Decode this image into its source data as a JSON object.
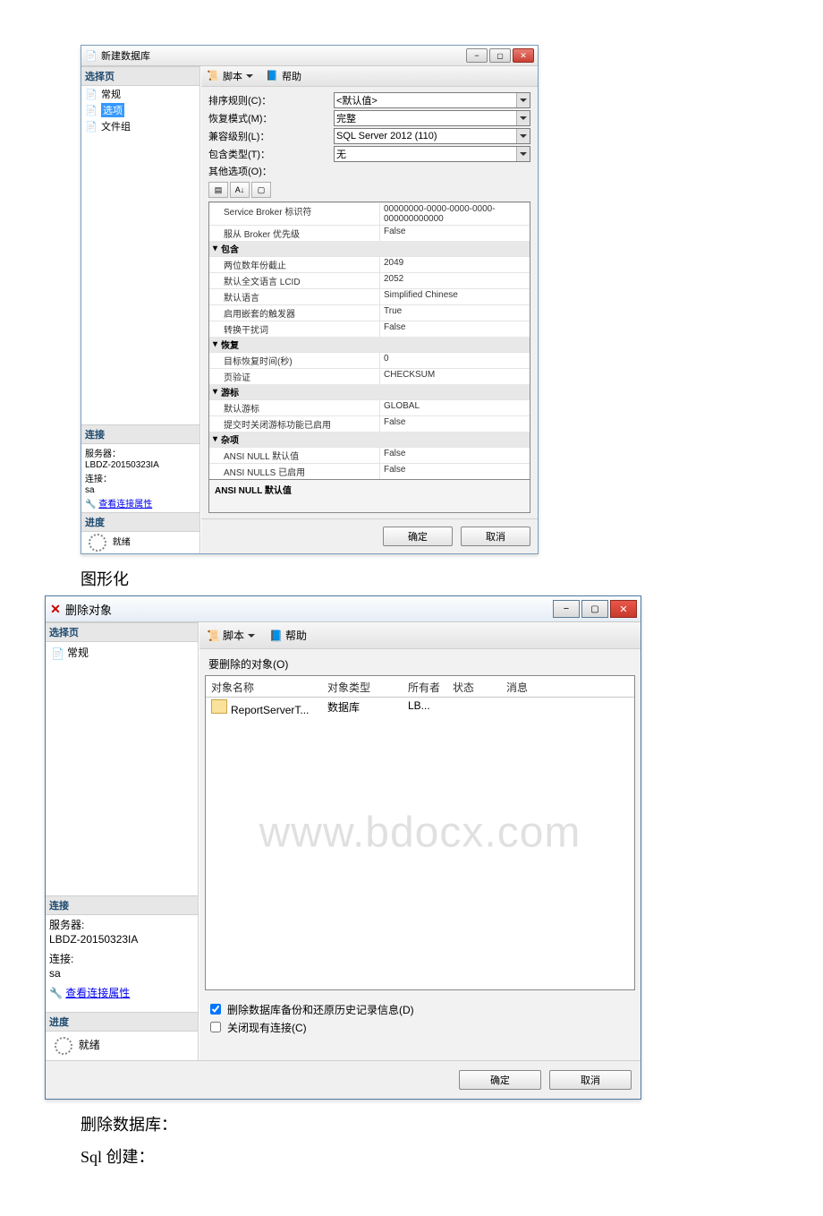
{
  "win1": {
    "title": "新建数据库",
    "select_page_header": "选择页",
    "pages": {
      "p0": "常规",
      "p1": "选项",
      "p2": "文件组"
    },
    "conn_header": "连接",
    "server_label": "服务器：",
    "server_value": "LBDZ-20150323IA",
    "conn_label": "连接：",
    "conn_value": "sa",
    "view_conn_props": "查看连接属性",
    "progress_header": "进度",
    "ready": "就绪",
    "toolbar_script": "脚本",
    "toolbar_help": "帮助",
    "form": {
      "collation_label": "排序规则(C)：",
      "collation_value": "<默认值>",
      "recovery_label": "恢复模式(M)：",
      "recovery_value": "完整",
      "compat_label": "兼容级别(L)：",
      "compat_value": "SQL Server 2012 (110)",
      "containment_label": "包含类型(T)：",
      "containment_value": "无",
      "other_label": "其他选项(O)："
    },
    "grid": {
      "sb_id_label": "Service Broker 标识符",
      "sb_id_val": "00000000-0000-0000-0000-000000000000",
      "broker_priority_label": "服从 Broker 优先级",
      "broker_priority_val": "False",
      "grp_containment": "包含",
      "two_digit_label": "两位数年份截止",
      "two_digit_val": "2049",
      "lcid_label": "默认全文语言 LCID",
      "lcid_val": "2052",
      "lang_label": "默认语言",
      "lang_val": "Simplified Chinese",
      "nested_label": "启用嵌套的触发器",
      "nested_val": "True",
      "noise_label": "转换干扰词",
      "noise_val": "False",
      "grp_recovery": "恢复",
      "target_time_label": "目标恢复时间(秒)",
      "target_time_val": "0",
      "page_verify_label": "页验证",
      "page_verify_val": "CHECKSUM",
      "grp_cursor": "游标",
      "default_cursor_label": "默认游标",
      "default_cursor_val": "GLOBAL",
      "commit_cursor_label": "提交时关闭游标功能已启用",
      "commit_cursor_val": "False",
      "grp_misc": "杂项",
      "ansi_null_def_label": "ANSI NULL 默认值",
      "ansi_null_def_val": "False",
      "ansi_nulls_enabled_label": "ANSI NULLS 已启用",
      "ansi_nulls_enabled_val": "False"
    },
    "desc_title": "ANSI NULL 默认值",
    "ok": "确定",
    "cancel": "取消"
  },
  "caption_graphical": "图形化",
  "win2": {
    "title": "删除对象",
    "select_page_header": "选择页",
    "page_general": "常规",
    "conn_header": "连接",
    "server_label": "服务器:",
    "server_value": "LBDZ-20150323IA",
    "conn_label": "连接:",
    "conn_value": "sa",
    "view_conn_props": "查看连接属性",
    "progress_header": "进度",
    "ready": "就绪",
    "toolbar_script": "脚本",
    "toolbar_help": "帮助",
    "objects_to_delete": "要删除的对象(O)",
    "col_name": "对象名称",
    "col_type": "对象类型",
    "col_owner": "所有者",
    "col_state": "状态",
    "col_msg": "消息",
    "row_name": "ReportServerT...",
    "row_type": "数据库",
    "row_owner": "LB...",
    "watermark": "www.bdocx.com",
    "chk_delete_history": "删除数据库备份和还原历史记录信息(D)",
    "chk_close_conn": "关闭现有连接(C)",
    "ok": "确定",
    "cancel": "取消"
  },
  "text_delete_db": "删除数据库：",
  "text_sql_create": "Sql 创建："
}
